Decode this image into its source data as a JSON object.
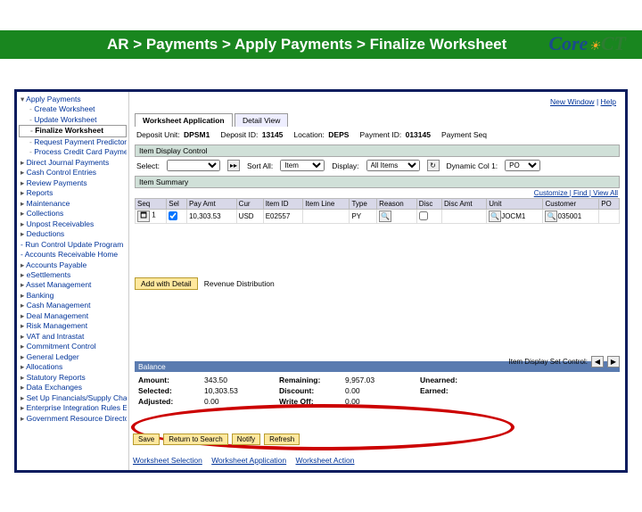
{
  "logo": {
    "part1": "Core",
    "part2": "CT"
  },
  "breadcrumb": "AR > Payments > Apply Payments > Finalize Worksheet",
  "toplinks": {
    "newwin": "New Window",
    "help": "Help"
  },
  "sidebar": {
    "items": [
      {
        "t": "open",
        "l": "Apply Payments"
      },
      {
        "t": "sub",
        "l": "Create Worksheet"
      },
      {
        "t": "sub",
        "l": "Update Worksheet"
      },
      {
        "t": "active",
        "l": "Finalize Worksheet"
      },
      {
        "t": "sub",
        "l": "Request Payment Predictor"
      },
      {
        "t": "sub",
        "l": "Process Credit Card Payments"
      },
      {
        "t": "tri",
        "l": "Direct Journal Payments"
      },
      {
        "t": "tri",
        "l": "Cash Control Entries"
      },
      {
        "t": "tri",
        "l": "Review Payments"
      },
      {
        "t": "tri",
        "l": "Reports"
      },
      {
        "t": "tri",
        "l": "Maintenance"
      },
      {
        "t": "tri",
        "l": "Collections"
      },
      {
        "t": "tri",
        "l": "Unpost Receivables"
      },
      {
        "t": "tri",
        "l": "Deductions"
      },
      {
        "t": "plain",
        "l": "- Run Control Update Program"
      },
      {
        "t": "plain",
        "l": "- Accounts Receivable Home"
      },
      {
        "t": "tri",
        "l": "Accounts Payable"
      },
      {
        "t": "tri",
        "l": "eSettlements"
      },
      {
        "t": "tri",
        "l": "Asset Management"
      },
      {
        "t": "tri",
        "l": "Banking"
      },
      {
        "t": "tri",
        "l": "Cash Management"
      },
      {
        "t": "tri",
        "l": "Deal Management"
      },
      {
        "t": "tri",
        "l": "Risk Management"
      },
      {
        "t": "tri",
        "l": "VAT and Intrastat"
      },
      {
        "t": "tri",
        "l": "Commitment Control"
      },
      {
        "t": "tri",
        "l": "General Ledger"
      },
      {
        "t": "tri",
        "l": "Allocations"
      },
      {
        "t": "tri",
        "l": "Statutory Reports"
      },
      {
        "t": "tri",
        "l": "Data Exchanges"
      },
      {
        "t": "tri",
        "l": "Set Up Financials/Supply Chain"
      },
      {
        "t": "tri",
        "l": "Enterprise Integration Rules EDK"
      },
      {
        "t": "tri",
        "l": "Government Resource Directory"
      }
    ]
  },
  "tabs": {
    "t1": "Worksheet Application",
    "t2": "Detail View"
  },
  "fields": {
    "depunit_lbl": "Deposit Unit:",
    "depunit": "DPSM1",
    "depid_lbl": "Deposit ID:",
    "depid": "13145",
    "loc_lbl": "Location:",
    "loc": "DEPS",
    "payid_lbl": "Payment ID:",
    "payid": "013145",
    "payseq_lbl": "Payment Seq"
  },
  "section1": "Item Display Control",
  "ctrl": {
    "select_lbl": "Select:",
    "sort_lbl": "Sort All:",
    "sort_val": "Item",
    "disp_lbl": "Display:",
    "disp_val": "All Items",
    "dyncol_lbl": "Dynamic Col 1:",
    "dyncol_val": "PO"
  },
  "section2": "Item Summary",
  "tablelinks": "Customize | Find | View All",
  "th": {
    "seq": "Seq",
    "sel": "Sel",
    "pay": "Pay Amt",
    "cur": "Cur",
    "item": "Item ID",
    "line": "Item Line",
    "type": "Type",
    "reason": "Reason",
    "disc": "Disc",
    "discamt": "Disc Amt",
    "unit": "Unit",
    "cust": "Customer",
    "po": "PO"
  },
  "row": {
    "seq": "1",
    "pay": "10,303.53",
    "cur": "USD",
    "item": "E02557",
    "type": "PY",
    "unit": "JOCM1",
    "cust": "035001"
  },
  "actbtn": "Add with Detail",
  "acttxt": "Revenue Distribution",
  "rightlbl": "Item Display Set Control:",
  "balhead": "Balance",
  "bal": {
    "amt_l": "Amount:",
    "amt_v": "343.50",
    "sel_l": "Selected:",
    "sel_v": "10,303.53",
    "adj_l": "Adjusted:",
    "adj_v": "0.00",
    "rem_l": "Remaining:",
    "rem_v": "9,957.03",
    "disc_l": "Discount:",
    "disc_v": "0.00",
    "wo_l": "Write Off:",
    "wo_v": "0.00",
    "un_l": "Unearned:",
    "ea_l": "Earned:"
  },
  "btns": {
    "save": "Save",
    "ret": "Return to Search",
    "not": "Notify",
    "ref": "Refresh"
  },
  "btabs": {
    "t1": "Worksheet Selection",
    "t2": "Worksheet Application",
    "t3": "Worksheet Action"
  }
}
